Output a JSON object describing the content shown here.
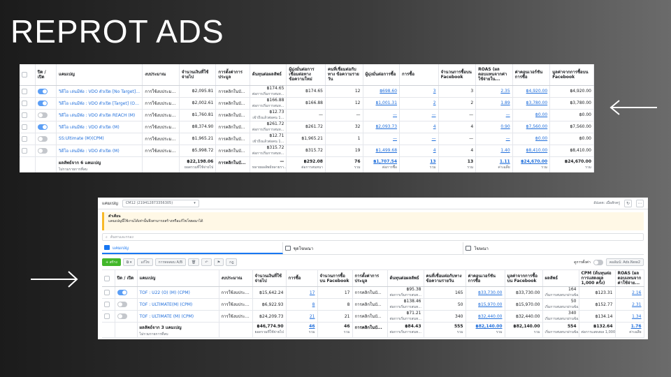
{
  "page": {
    "title": "REPROT ADS"
  },
  "panel1": {
    "columns": [
      "ปิด / เปิด",
      "แคมเปญ",
      "งบประมาณ",
      "จำนวนเงินที่ใช้จ่ายไป",
      "การตั้งค่าการประมูล",
      "ต้นทุนต่อผลลัพธ์",
      "ผู้มุ่งมั่นต่อการเชื่อมต่อทาง ข้อความใหม่",
      "คนที่เชื่อมต่อกับทาง ข้อความรายวัน",
      "ผู้มุ่งมั่นต่อการซื้อ",
      "การซื้อ",
      "จำนวนการซื้อบน Facebook",
      "ROAS (ผลตอบแทนจากค่าใช้จ่ายใน...",
      "ค่าคอนเวอร์ชันการซื้อ",
      "มูลค่าจากการซื้อบน Facebook"
    ],
    "rows": [
      {
        "on": true,
        "name": "วิดีโอ เล่นมีพัง : VDO ตัวเปิด [No Target] (O) (M)",
        "budget": "การใช้งบประมะ...",
        "spent": "฿2,095.81",
        "bid": "การคลิกในบั...",
        "cost": "฿174.65",
        "cost_sub": "ต่อการเริ่มการสนท...",
        "new_msg": "฿174.65",
        "daily_conn": "12",
        "cost_purchase": "฿698.60",
        "purchases": "3",
        "fb_purchases": "3",
        "roas": "2.35",
        "conv_value": "฿4,920.00",
        "fb_value": "฿4,920.00"
      },
      {
        "on": true,
        "name": "วิดีโอ เล่นมีพัง : VDO ตัวเปิด [Target] (O) (M)",
        "budget": "การใช้งบประมะ...",
        "spent": "฿2,002.61",
        "bid": "การคลิกในบั...",
        "cost": "฿166.88",
        "cost_sub": "ต่อการเริ่มการสนท...",
        "new_msg": "฿166.88",
        "daily_conn": "12",
        "cost_purchase": "฿1,001.31",
        "purchases": "2",
        "fb_purchases": "2",
        "roas": "1.89",
        "conv_value": "฿3,780.00",
        "fb_value": "฿3,780.00"
      },
      {
        "on": false,
        "name": "วิดีโอ เล่นมีพัง : VDO ตัวเปิด REACH (M)",
        "budget": "การใช้งบประมะ...",
        "spent": "฿1,760.81",
        "bid": "การคลิกในบั...",
        "cost": "฿12.73",
        "cost_sub": "เข้าถึงแล้วต่อคน 1...",
        "new_msg": "—",
        "daily_conn": "—",
        "cost_purchase": "—",
        "purchases": "—",
        "fb_purchases": "—",
        "roas": "—",
        "conv_value": "฿0.00",
        "fb_value": "฿0.00"
      },
      {
        "on": true,
        "name": "วิดีโอ เล่นมีพัง : VDO ตัวเปิด (M)",
        "budget": "การใช้งบประมะ...",
        "spent": "฿8,374.90",
        "bid": "การคลิกในบั...",
        "cost": "฿261.72",
        "cost_sub": "ต่อการเริ่มการสนท...",
        "new_msg": "฿261.72",
        "daily_conn": "32",
        "cost_purchase": "฿2,093.73",
        "purchases": "4",
        "fb_purchases": "4",
        "roas": "0.90",
        "conv_value": "฿7,560.00",
        "fb_value": "฿7,560.00"
      },
      {
        "on": false,
        "name": "SS:Ultimate (M)(CPM)",
        "budget": "การใช้งบประมะ...",
        "spent": "฿1,965.21",
        "bid": "การคลิกในบั...",
        "cost": "฿12.71",
        "cost_sub": "เข้าถึงแล้วต่อคน 1...",
        "new_msg": "฿1,965.21",
        "daily_conn": "1",
        "cost_purchase": "—",
        "purchases": "—",
        "fb_purchases": "—",
        "roas": "—",
        "conv_value": "฿0.00",
        "fb_value": "฿0.00"
      },
      {
        "on": false,
        "name": "วิดีโอ เล่นมีพัง : VDO ตัวเปิด (M)",
        "budget": "การใช้งบประมะ...",
        "spent": "฿5,998.72",
        "bid": "การคลิกในบั...",
        "cost": "฿315.72",
        "cost_sub": "ต่อการเริ่มการสนท...",
        "new_msg": "฿315.72",
        "daily_conn": "19",
        "cost_purchase": "฿1,499.68",
        "purchases": "4",
        "fb_purchases": "4",
        "roas": "1.40",
        "conv_value": "฿8,410.00",
        "fb_value": "฿8,410.00"
      }
    ],
    "total": {
      "name": "ผลลัพธ์จาก 6 แคมเปญ",
      "name_sub": "ไม่รวมรายการที่ลบ",
      "spent": "฿22,198.06",
      "spent_sub": "ยอดรวมที่ใช้จ่ายไป",
      "bid": "การคลิกในบั...",
      "cost": "—",
      "cost_sub": "หลายผลลัพธ์หลายรา...",
      "new_msg": "฿292.08",
      "new_msg_sub": "ต่อการสนทนา",
      "daily_conn": "76",
      "daily_conn_sub": "รวม",
      "cost_purchase": "฿1,707.54",
      "cost_purchase_sub": "ต่อการซื้อ",
      "purchases": "13",
      "purchases_sub": "รวม",
      "fb_purchases": "13",
      "fb_purchases_sub": "รวม",
      "roas": "1.11",
      "roas_sub": "ค่าเฉลี่ย",
      "conv_value": "฿24,670.00",
      "conv_value_sub": "รวม",
      "fb_value": "฿24,670.00",
      "fb_value_sub": "รวม"
    }
  },
  "panel2": {
    "account_label": "แคมเปญ",
    "account_select": "CM12 (219412873356305)",
    "top_right_text": "อัปเดต: เมื่อสักครู่",
    "warning_title": "คำเตือน",
    "warning_text": "แคมเปญนี้ใช้งานได้เท่านั้นจึงสามารถสร้างหรือแก้ไขโฆษณาได้",
    "search_placeholder": "ค้นหาและกรอง",
    "tabs": [
      "แคมเปญ",
      "ชุดโฆษณา",
      "โฆษณา"
    ],
    "toolbar": {
      "create": "+ สร้าง",
      "edit": "แก้ไข",
      "ab_test": "การทดสอบ A/B",
      "rules": "กฎ",
      "breakdown_label": "ดูการตั้งค่า",
      "columns_label": "คอลัมน์: Ads.New2"
    },
    "columns": [
      "ปิด / เปิด",
      "แคมเปญ",
      "งบประมาณ",
      "จำนวนเงินที่ใช้จ่ายไป",
      "การซื้อ",
      "จำนวนการซื้อบน Facebook",
      "การตั้งค่าการประมูล",
      "ต้นทุนต่อผลลัพธ์",
      "คนที่เชื่อมต่อกับทาง ข้อความรายวัน",
      "ค่าคอนเวอร์ชันการซื้อ",
      "มูลค่าจากการซื้อบน Facebook",
      "ผลลัพธ์",
      "CPM (ต้นทุนต่อการแสดงผล 1,000 ครั้ง)",
      "ROAS (ผลตอบแทนจากค่าใช้จ่าย..."
    ],
    "rows": [
      {
        "on": true,
        "name": "TOF : U22 (O) (M) (CPM)",
        "budget": "การใช้งบประมะ...",
        "spent": "฿15,642.24",
        "purchases": "17",
        "fb_purchases": "17",
        "bid": "การคลิกในบั...",
        "cost": "฿95.38",
        "cost_sub": "ต่อการเริ่มการสนท...",
        "daily_conn": "165",
        "conv_value": "฿33,730.00",
        "fb_value": "฿33,730.00",
        "results": "164",
        "results_sub": "เริ่มการสนทนาผ่านข้อ...",
        "cpm": "฿123.31",
        "roas": "2.16"
      },
      {
        "on": false,
        "name": "TOF : ULTIMATE(M) (CPM)",
        "budget": "การใช้งบประมะ...",
        "spent": "฿6,922.93",
        "purchases": "8",
        "fb_purchases": "8",
        "bid": "การคลิกในบั...",
        "cost": "฿138.46",
        "cost_sub": "ต่อการเริ่มการสนท...",
        "daily_conn": "50",
        "conv_value": "฿15,970.00",
        "fb_value": "฿15,970.00",
        "results": "50",
        "results_sub": "เริ่มการสนทนาผ่านข้อ...",
        "cpm": "฿152.77",
        "roas": "2.31"
      },
      {
        "on": false,
        "name": "TOF : ULTIMATE (M) (CPM)",
        "budget": "การใช้งบประมะ...",
        "spent": "฿24,209.73",
        "purchases": "21",
        "fb_purchases": "21",
        "bid": "การคลิกในบั...",
        "cost": "฿71.21",
        "cost_sub": "ต่อการเริ่มการสนท...",
        "daily_conn": "340",
        "conv_value": "฿32,440.00",
        "fb_value": "฿32,440.00",
        "results": "340",
        "results_sub": "เริ่มการสนทนาผ่านข้อ...",
        "cpm": "฿134.14",
        "roas": "1.34"
      }
    ],
    "total": {
      "name": "ผลลัพธ์จาก 3 แคมเปญ",
      "name_sub": "ไม่รวมรายการที่ลบ",
      "spent": "฿46,774.90",
      "spent_sub": "ยอดรวมที่ใช้จ่ายไป",
      "purchases": "46",
      "purchases_sub": "รวม",
      "fb_purchases": "46",
      "fb_purchases_sub": "รวม",
      "bid": "การคลิกในบั...",
      "cost": "฿84.43",
      "cost_sub": "ต่อการเริ่มการสนท...",
      "daily_conn": "555",
      "daily_conn_sub": "รวม",
      "conv_value": "฿82,140.00",
      "conv_value_sub": "รวม",
      "fb_value": "฿82,140.00",
      "fb_value_sub": "รวม",
      "results": "554",
      "results_sub": "เริ่มการสนทนาผ่านข้อ...",
      "cpm": "฿132.64",
      "cpm_sub": "ต่อการแสดงผล 1,000 ครั้ง",
      "roas": "1.76",
      "roas_sub": "ค่าเฉลี่ย"
    }
  }
}
